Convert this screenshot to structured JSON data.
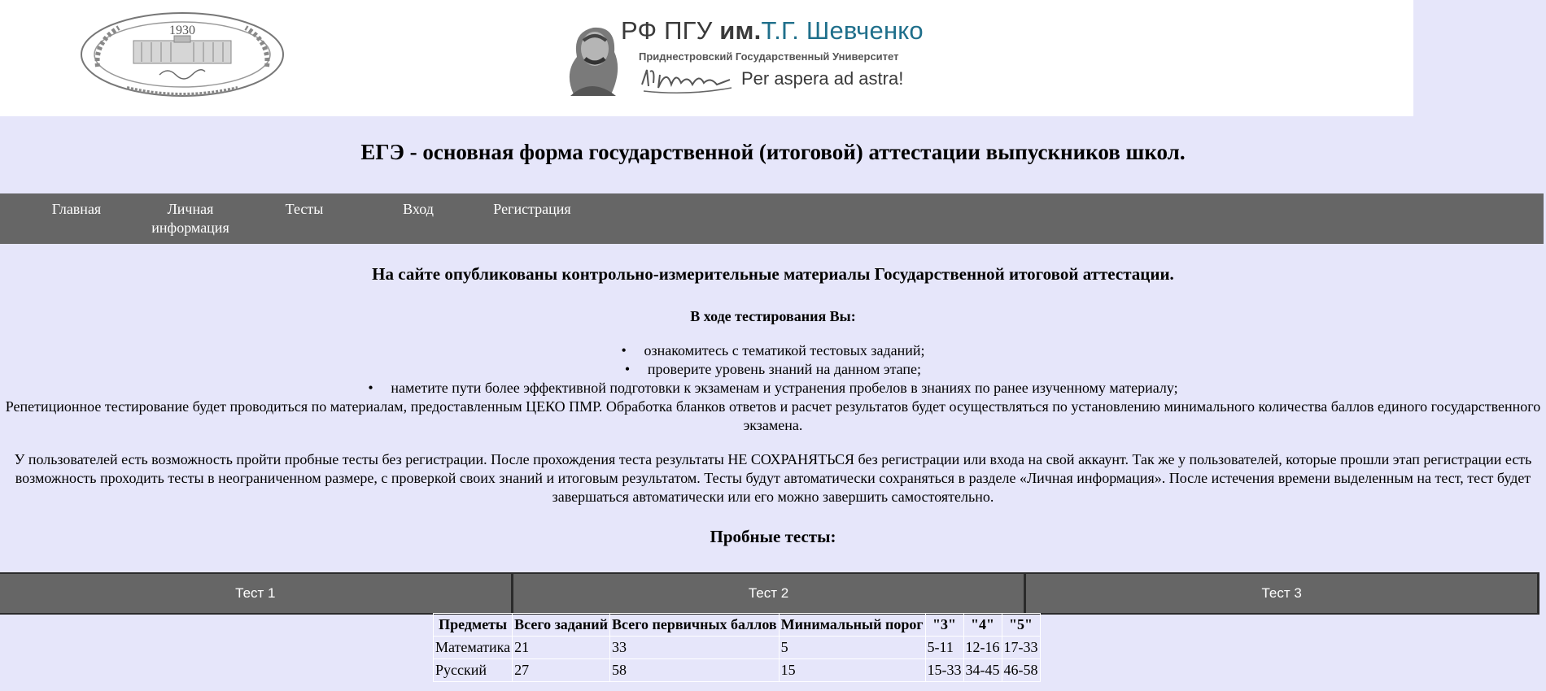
{
  "banner": {
    "seal_year": "1930",
    "seal_alt": "university-seal",
    "logo_prefix": "РФ ПГУ ",
    "logo_im": "им.",
    "logo_name": "Т.Г. Шевченко",
    "logo_subtitle": "Приднестровский Государственный Университет",
    "logo_motto": "Per aspera ad astra!"
  },
  "page": {
    "title": "ЕГЭ - основная форма государственной (итоговой) аттестации выпускников школ."
  },
  "nav": {
    "items": [
      {
        "label": "Главная"
      },
      {
        "label": "Личная информация"
      },
      {
        "label": "Тесты"
      },
      {
        "label": "Вход"
      },
      {
        "label": "Регистрация"
      }
    ]
  },
  "content": {
    "notice": "На сайте опубликованы контрольно-измерительные материалы Государственной итоговой аттестации.",
    "during_title": "В ходе тестирования Вы:",
    "bullets": [
      "ознакомитесь с тематикой тестовых заданий;",
      "проверите уровень знаний на данном этапе;",
      "наметите пути более эффективной подготовки к экзаменам и устранения пробелов в знаниях по ранее изученному материалу;"
    ],
    "paragraph_1": "Репетиционное тестирование будет проводиться по материалам, предоставленным ЦЕКО ПМР. Обработка бланков ответов и расчет результатов будет осуществляться по установлению минимального количества баллов единого государственного экзамена.",
    "paragraph_2": "У пользователей есть возможность пройти пробные тесты без регистрации. После прохождения теста результаты НЕ СОХРАНЯТЬСЯ без регистрации или входа на свой аккаунт. Так же у пользователей, которые прошли этап регистрации есть возможность проходить тесты в неограниченном размере, с проверкой своих знаний и итоговым результатом. Тесты будут автоматически сохраняться в разделе «Личная информация». После истечения времени выделенным на тест, тест будет завершаться автоматически или его можно завершить самостоятельно.",
    "trial_title": "Пробные тесты:"
  },
  "tests": [
    {
      "label": "Тест 1"
    },
    {
      "label": "Тест 2"
    },
    {
      "label": "Тест 3"
    }
  ],
  "table": {
    "headers": [
      "Предметы",
      "Всего заданий",
      "Всего первичных баллов",
      "Минимальный порог",
      "\"3\"",
      "\"4\"",
      "\"5\""
    ],
    "rows": [
      [
        "Математика",
        "21",
        "33",
        "5",
        "5-11",
        "12-16",
        "17-33"
      ],
      [
        "Русский",
        "27",
        "58",
        "15",
        "15-33",
        "34-45",
        "46-58"
      ]
    ]
  }
}
